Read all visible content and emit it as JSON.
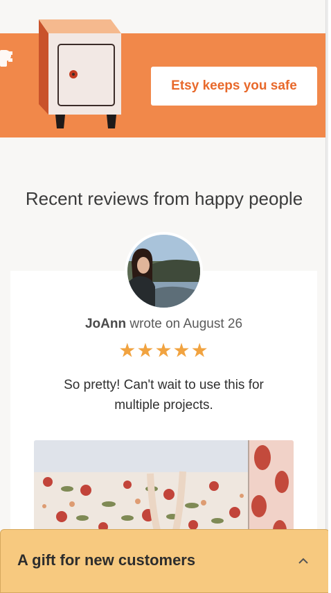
{
  "banner": {
    "button_label": "Etsy keeps you safe",
    "illustration_icon": "safe-icon"
  },
  "reviews_section": {
    "title": "Recent reviews from happy people"
  },
  "review": {
    "author": "JoAnn",
    "meta_text": "wrote on August 26",
    "rating": 5,
    "stars": "★★★★★",
    "text": "So pretty! Can't wait to use this for multiple projects."
  },
  "gift_drawer": {
    "label": "A gift for new customers",
    "icon": "chevron-up-icon"
  },
  "colors": {
    "banner": "#f1884a",
    "accent_text": "#e8692b",
    "stars": "#f1a340",
    "drawer": "#f7c97f"
  }
}
